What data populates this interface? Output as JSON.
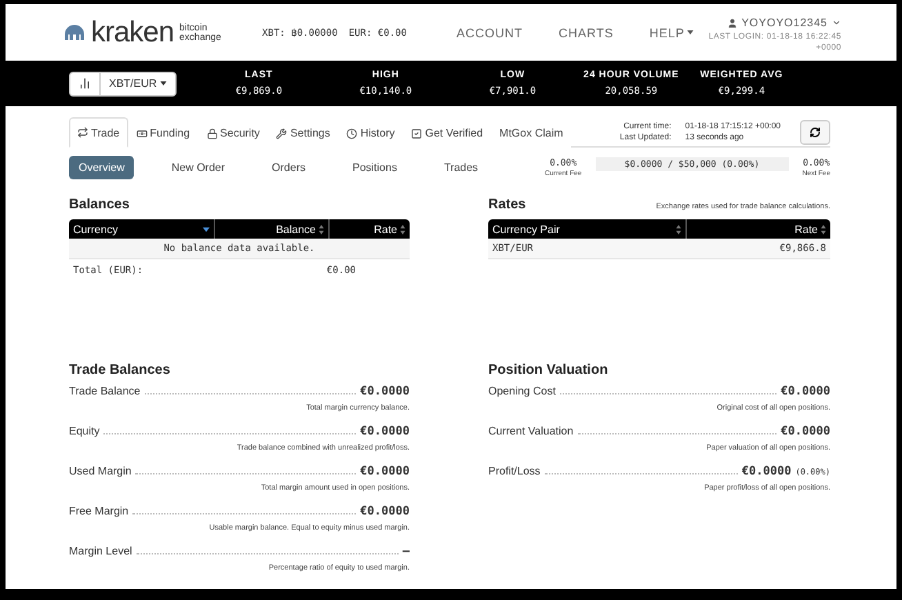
{
  "header": {
    "logo": {
      "name": "kraken",
      "tagline": "bitcoin exchange"
    },
    "wallet": [
      "XBT: ฿0.00000",
      "EUR: €0.00"
    ],
    "nav": [
      {
        "label": "ACCOUNT",
        "kind": "link"
      },
      {
        "label": "CHARTS",
        "kind": "link"
      },
      {
        "label": "HELP",
        "kind": "dropdown"
      }
    ],
    "user": {
      "name": "YOYOYO12345",
      "last_login": "LAST LOGIN: 01-18-18 16:22:45 +0000"
    }
  },
  "ticker": {
    "pair": "XBT/EUR",
    "stats": [
      {
        "label": "LAST",
        "value": "€9,869.0"
      },
      {
        "label": "HIGH",
        "value": "€10,140.0"
      },
      {
        "label": "LOW",
        "value": "€7,901.0"
      },
      {
        "label": "24 HOUR VOLUME",
        "value": "20,058.59"
      },
      {
        "label": "WEIGHTED AVG",
        "value": "€9,299.4"
      }
    ]
  },
  "tabs": [
    {
      "label": "Trade",
      "selected": true
    },
    {
      "label": "Funding",
      "selected": false
    },
    {
      "label": "Security",
      "selected": false
    },
    {
      "label": "Settings",
      "selected": false
    },
    {
      "label": "History",
      "selected": false
    },
    {
      "label": "Get Verified",
      "selected": false
    },
    {
      "label": "MtGox Claim",
      "selected": false
    }
  ],
  "status": [
    {
      "label": "Current time:",
      "value": "01-18-18 17:15:12 +00:00"
    },
    {
      "label": "Last Updated:",
      "value": "13 seconds ago"
    }
  ],
  "subtabs": [
    {
      "label": "Overview",
      "selected": true
    },
    {
      "label": "New Order",
      "selected": false
    },
    {
      "label": "Orders",
      "selected": false
    },
    {
      "label": "Positions",
      "selected": false
    },
    {
      "label": "Trades",
      "selected": false
    }
  ],
  "fees": {
    "current": "0.00%",
    "current_label": "Current Fee",
    "volume": "$0.0000 / $50,000 (0.00%)",
    "next": "0.00%",
    "next_label": "Next Fee"
  },
  "balances": {
    "title": "Balances",
    "columns": [
      {
        "label": "Currency",
        "sorted": true
      },
      {
        "label": "Balance",
        "sorted": false
      },
      {
        "label": "Rate",
        "sorted": false
      }
    ],
    "empty": "No balance data available.",
    "total_label": "Total (EUR):",
    "total_value": "€0.00"
  },
  "rates": {
    "title": "Rates",
    "note": "Exchange rates used for trade balance calculations.",
    "columns": [
      {
        "label": "Currency Pair",
        "sorted": false
      },
      {
        "label": "Rate",
        "sorted": false
      }
    ],
    "rows": [
      [
        "XBT/EUR",
        "€9,866.8"
      ]
    ]
  },
  "trade_balances": {
    "title": "Trade Balances",
    "items": [
      {
        "label": "Trade Balance",
        "value": "€0.0000",
        "description": "Total margin currency balance."
      },
      {
        "label": "Equity",
        "value": "€0.0000",
        "description": "Trade balance combined with unrealized profit/loss."
      },
      {
        "label": "Used Margin",
        "value": "€0.0000",
        "description": "Total margin amount used in open positions."
      },
      {
        "label": "Free Margin",
        "value": "€0.0000",
        "description": "Usable margin balance. Equal to equity minus used margin."
      },
      {
        "label": "Margin Level",
        "value": "—",
        "description": "Percentage ratio of equity to used margin."
      }
    ]
  },
  "position_valuation": {
    "title": "Position Valuation",
    "items": [
      {
        "label": "Opening Cost",
        "value": "€0.0000",
        "description": "Original cost of all open positions."
      },
      {
        "label": "Current Valuation",
        "value": "€0.0000",
        "description": "Paper valuation of all open positions."
      },
      {
        "label": "Profit/Loss",
        "value": "€0.0000",
        "extra": "(0.00%)",
        "description": "Paper profit/loss of all open positions."
      }
    ]
  }
}
